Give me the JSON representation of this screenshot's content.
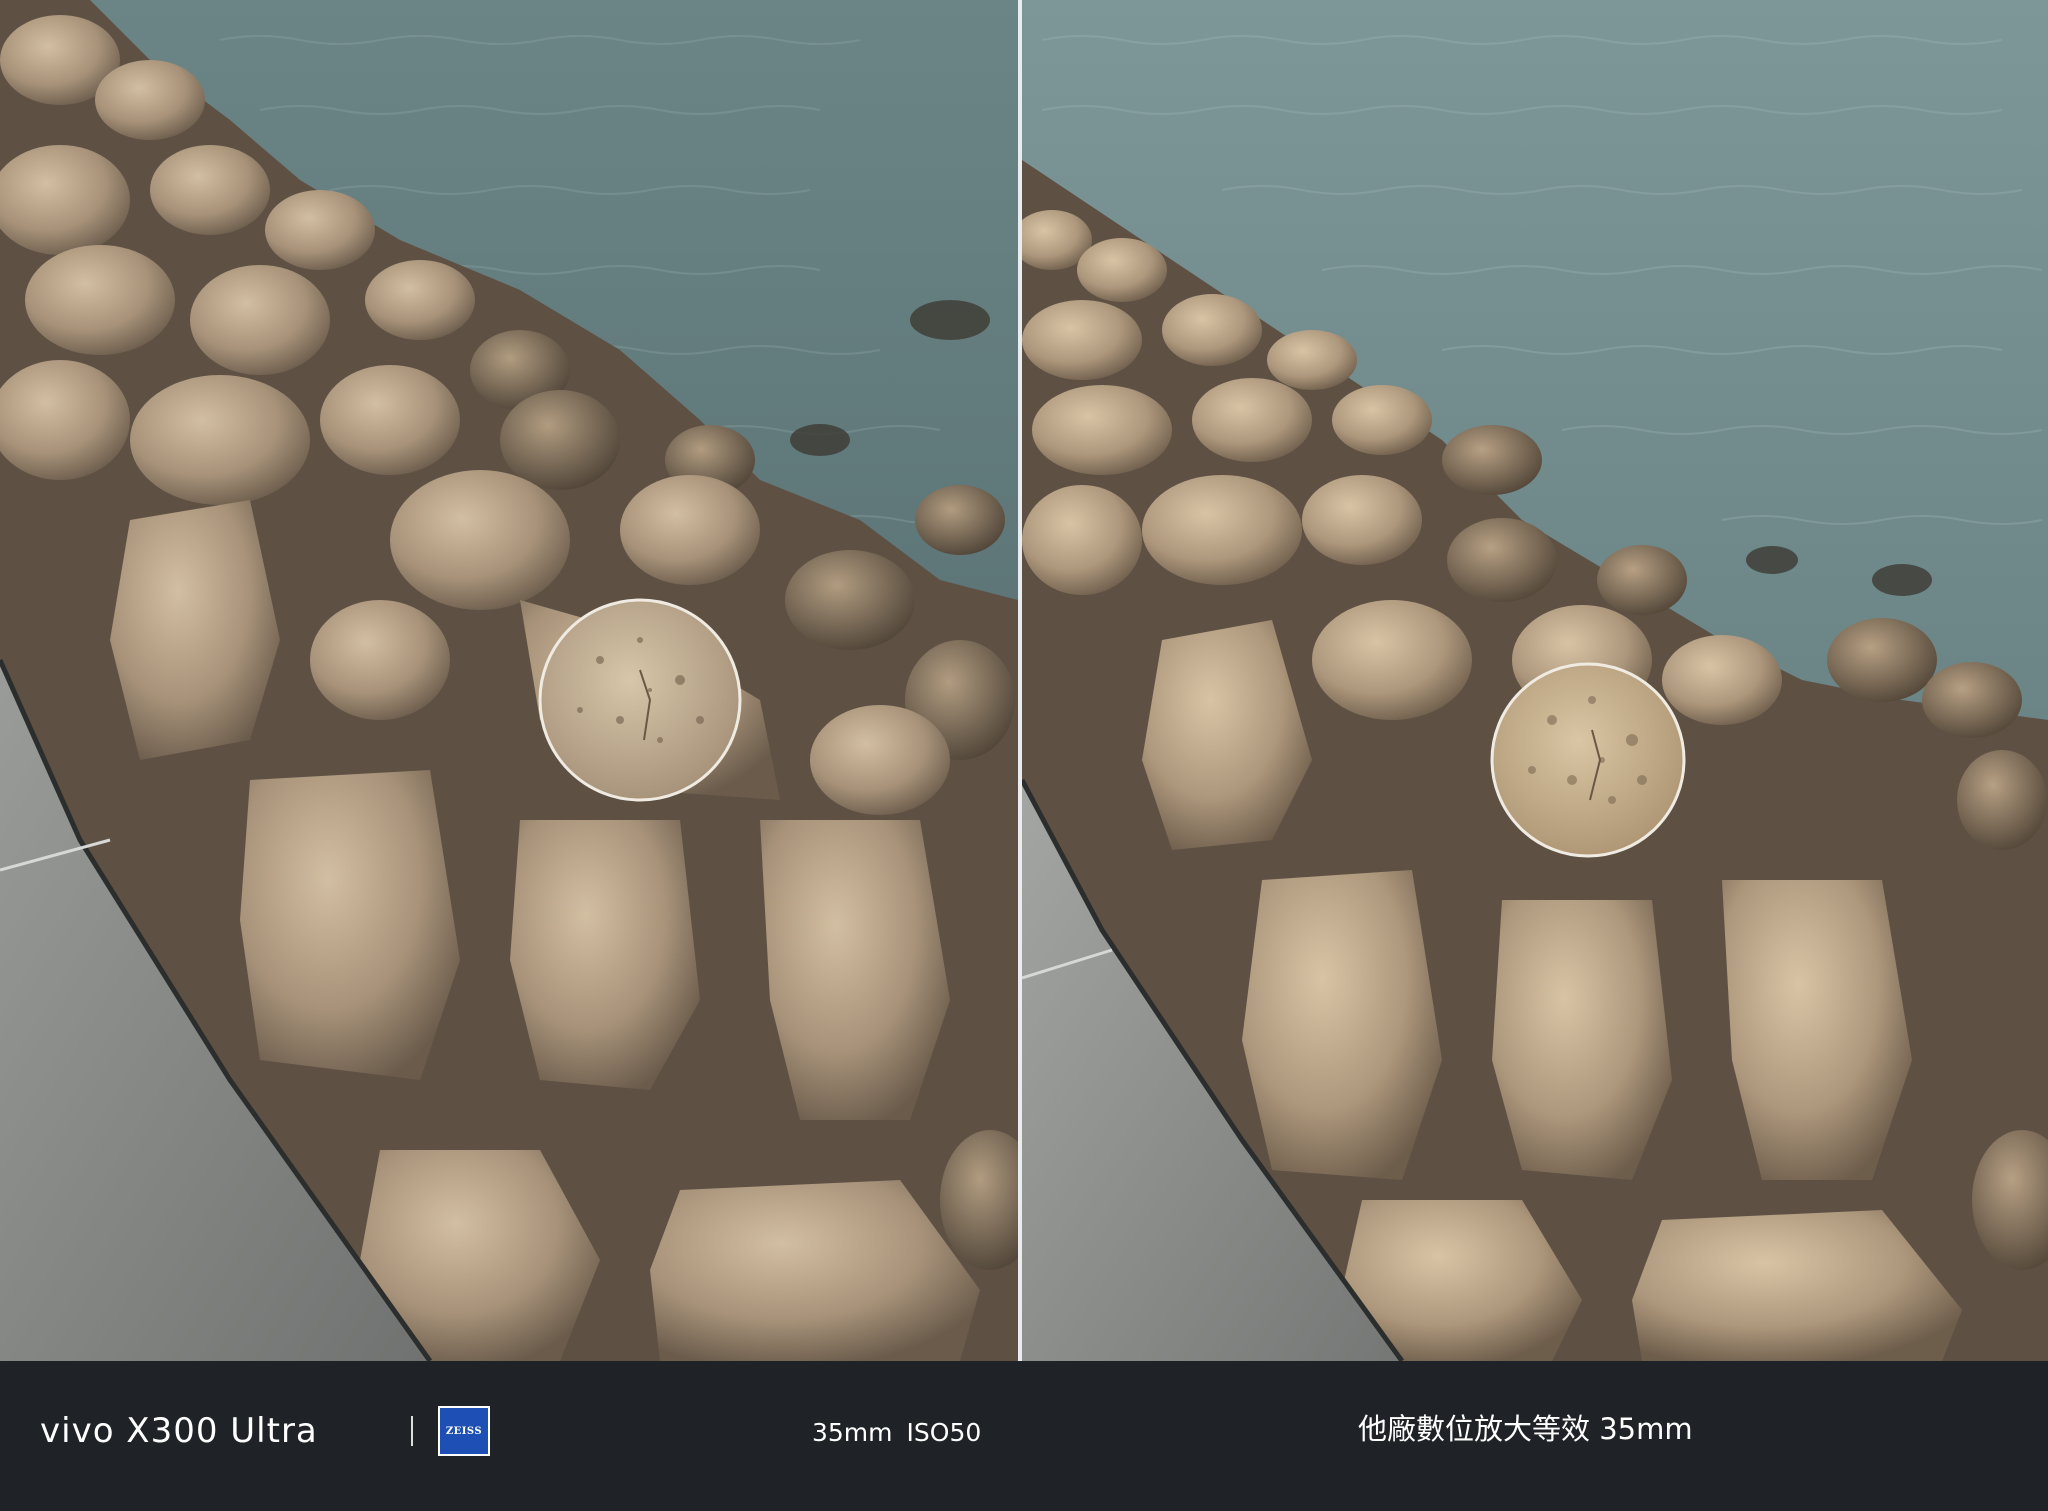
{
  "left_panel": {
    "brand_text": "vivo X300 Ultra",
    "logo_text": "ZEISS",
    "focal_length": "35mm",
    "iso": "ISO50"
  },
  "right_panel": {
    "caption": "他廠數位放大等效 35mm"
  },
  "colors": {
    "water": "#6f8a8d",
    "water_deep": "#5a7376",
    "rock": "#9c8a73",
    "rock_light": "#c9b69a",
    "rock_dark": "#5e5144",
    "walkway": "#8a8c8a",
    "walkway_dark": "#555857",
    "caption_bar": "#1f2226",
    "divider": "#e9edef",
    "zeiss_blue": "#1d4fb5"
  }
}
